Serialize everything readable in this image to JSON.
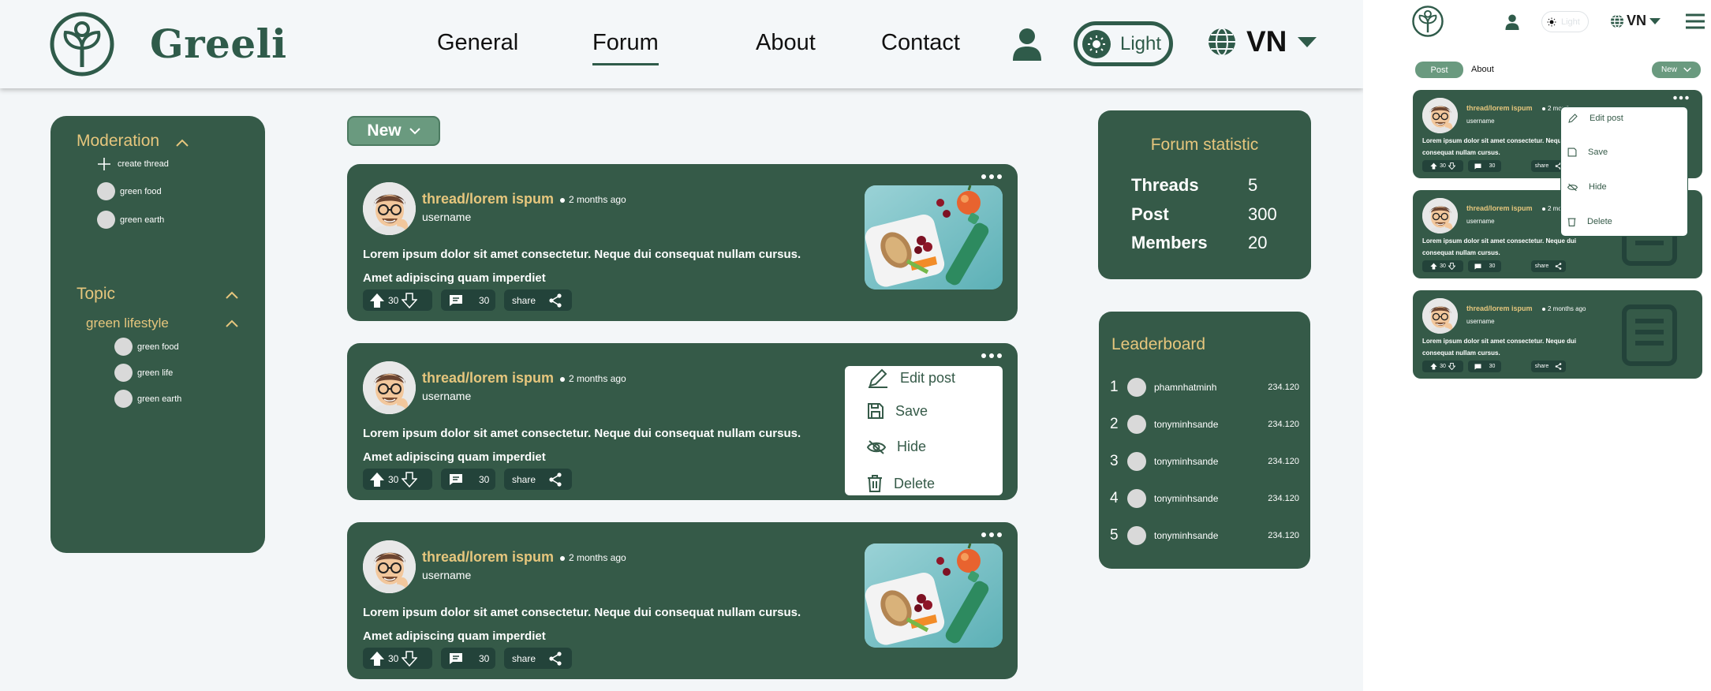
{
  "brand": {
    "name": "Greeli"
  },
  "nav": {
    "general": "General",
    "forum": "Forum",
    "about": "About",
    "contact": "Contact"
  },
  "theme": {
    "label": "Light"
  },
  "language": {
    "code": "VN"
  },
  "sidebar": {
    "moderation": {
      "title": "Moderation",
      "items": [
        "create thread",
        "green food",
        "green earth"
      ]
    },
    "topic": {
      "title": "Topic",
      "group": "green lifestyle",
      "items": [
        "green food",
        "green life",
        "green earth"
      ]
    }
  },
  "filter": {
    "label": "New"
  },
  "posts": [
    {
      "thread": "thread/lorem ispum",
      "time": "2 months ago",
      "username": "username",
      "body": "Lorem ipsum dolor sit amet consectetur. Neque dui consequat nullam cursus. Amet adipiscing quam imperdiet",
      "votes": "30",
      "comments": "30",
      "share": "share"
    },
    {
      "thread": "thread/lorem ispum",
      "time": "2 months ago",
      "username": "username",
      "body": "Lorem ipsum dolor sit amet consectetur. Neque dui consequat nullam cursus. Amet adipiscing quam imperdiet",
      "votes": "30",
      "comments": "30",
      "share": "share"
    },
    {
      "thread": "thread/lorem ispum",
      "time": "2 months ago",
      "username": "username",
      "body": "Lorem ipsum dolor sit amet consectetur. Neque dui consequat nullam cursus. Amet adipiscing quam imperdiet",
      "votes": "30",
      "comments": "30",
      "share": "share"
    }
  ],
  "post_menu": {
    "edit": "Edit post",
    "save": "Save",
    "hide": "Hide",
    "delete": "Delete"
  },
  "statistic": {
    "title": "Forum statistic",
    "rows": [
      {
        "label": "Threads",
        "value": "5"
      },
      {
        "label": "Post",
        "value": "300"
      },
      {
        "label": "Members",
        "value": "20"
      }
    ]
  },
  "leaderboard": {
    "title": "Leaderboard",
    "rows": [
      {
        "rank": "1",
        "name": "phamnhatminh",
        "points": "234.120"
      },
      {
        "rank": "2",
        "name": "tonyminhsande",
        "points": "234.120"
      },
      {
        "rank": "3",
        "name": "tonyminhsande",
        "points": "234.120"
      },
      {
        "rank": "4",
        "name": "tonyminhsande",
        "points": "234.120"
      },
      {
        "rank": "5",
        "name": "tonyminhsande",
        "points": "234.120"
      }
    ]
  },
  "mobile": {
    "theme_label": "Light",
    "language": "VN",
    "tabs": {
      "post": "Post",
      "about": "About"
    },
    "filter": "New",
    "posts": [
      {
        "thread": "thread/lorem ispum",
        "time": "2 months ago",
        "username": "username",
        "body": "Lorem ipsum dolor sit amet consectetur. Neque dui consequat nullam cursus.",
        "votes": "30",
        "comments": "30",
        "share": "share"
      },
      {
        "thread": "thread/lorem ispum",
        "time": "2 months ago",
        "username": "username",
        "body": "Lorem ipsum dolor sit amet consectetur. Neque dui consequat nullam cursus.",
        "votes": "30",
        "comments": "30",
        "share": "share"
      },
      {
        "thread": "thread/lorem ispum",
        "time": "2 months ago",
        "username": "username",
        "body": "Lorem ipsum dolor sit amet consectetur. Neque dui consequat nullam cursus.",
        "votes": "30",
        "comments": "30",
        "share": "share"
      }
    ],
    "menu": {
      "edit": "Edit post",
      "save": "Save",
      "hide": "Hide",
      "delete": "Delete"
    }
  },
  "colors": {
    "primary": "#355a48",
    "accent": "#e6c67d",
    "button_light": "#6a9a7f",
    "chip": "#23433a",
    "background": "#f3f6f8"
  }
}
